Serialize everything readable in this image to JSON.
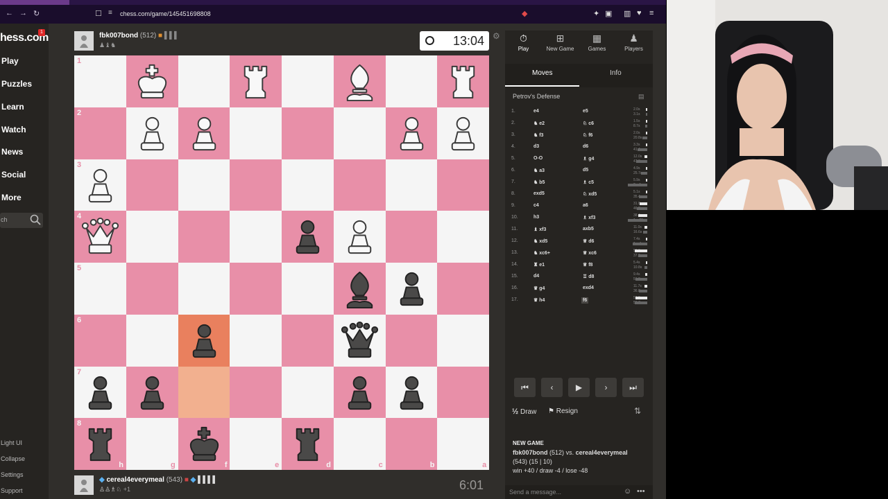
{
  "browser": {
    "url": "chess.com/game/145451698808"
  },
  "sidebar": {
    "logo": "hess.com",
    "badge": "1",
    "items": [
      "Play",
      "Puzzles",
      "Learn",
      "Watch",
      "News",
      "Social",
      "More"
    ],
    "search_placeholder": "ch",
    "footer": [
      "Light UI",
      "Collapse",
      "Settings",
      "Support"
    ]
  },
  "top_player": {
    "name": "fbk007bond",
    "rating": "(512)",
    "clock": "13:04"
  },
  "bottom_player": {
    "name": "cereal4everymeal",
    "rating": "(543)",
    "captured_extra": "+1",
    "clock": "6:01"
  },
  "board": {
    "ranks": [
      "1",
      "2",
      "3",
      "4",
      "5",
      "6",
      "7",
      "8"
    ],
    "files": [
      "h",
      "g",
      "f",
      "e",
      "d",
      "c",
      "b",
      "a"
    ]
  },
  "panel": {
    "tabs": [
      "Play",
      "New Game",
      "Games",
      "Players"
    ],
    "subtabs": [
      "Moves",
      "Info"
    ],
    "opening": "Petrov's Defense",
    "moves": [
      {
        "n": "1.",
        "w": "e4",
        "b": "e5",
        "tw": "2.0s",
        "tb": "3.1s"
      },
      {
        "n": "2.",
        "w": "e2",
        "b": "c6",
        "tw": "1.5s",
        "tb": "8.7s"
      },
      {
        "n": "3.",
        "w": "f3",
        "b": "f6",
        "tw": "2.0s",
        "tb": "20.8s"
      },
      {
        "n": "4.",
        "w": "d3",
        "b": "d6",
        "tw": "3.3s",
        "tb": "41.4s"
      },
      {
        "n": "5.",
        "w": "O-O",
        "b": "g4",
        "tw": "12.0s",
        "tb": "47.8s"
      },
      {
        "n": "6.",
        "w": "a3",
        "b": "d5",
        "tw": "4.9s",
        "tb": "25.7s"
      },
      {
        "n": "7.",
        "w": "b5",
        "b": "c5",
        "tw": "5.9s",
        "tb": "2m 1s"
      },
      {
        "n": "8.",
        "w": "exd5",
        "b": "xd5",
        "tw": "5.1s",
        "tb": "35.4s"
      },
      {
        "n": "9.",
        "w": "c4",
        "b": "a6",
        "tw": "31.8s",
        "tb": "46.2s"
      },
      {
        "n": "10.",
        "w": "h3",
        "b": "xf3",
        "tw": "38.4s",
        "tb": "1m 28s"
      },
      {
        "n": "11.",
        "w": "xf3",
        "b": "axb5",
        "tw": "11.0s",
        "tb": "16.6s"
      },
      {
        "n": "12.",
        "w": "xd5",
        "b": "d6",
        "tw": "7.4s",
        "tb": "1m 4s"
      },
      {
        "n": "13.",
        "w": "xc6+",
        "b": "xc6",
        "tw": "53.6s",
        "tb": "37.9s"
      },
      {
        "n": "14.",
        "w": "e1",
        "b": "f8",
        "tw": "5.4s",
        "tb": "10.8s"
      },
      {
        "n": "15.",
        "w": "d4",
        "b": "d8",
        "tw": "9.4s",
        "tb": "51.0s"
      },
      {
        "n": "16.",
        "w": "g4",
        "b": "exd4",
        "tw": "11.7s",
        "tb": "36.8s"
      },
      {
        "n": "17.",
        "w": "h4",
        "b": "f6",
        "tw": "50.0s",
        "tb": "53.7s"
      }
    ],
    "draw": "Draw",
    "draw_icon": "½",
    "resign": "Resign",
    "new_game_title": "NEW GAME",
    "ng_white": "fbk007bond",
    "ng_white_rating": "(512)",
    "ng_vs": "vs.",
    "ng_black": "cereal4everymeal",
    "ng_line2": "(543) (15 | 10)",
    "ng_line3": "win +40 / draw -4 / lose -48",
    "message_placeholder": "Send a message..."
  },
  "colors": {
    "light_square": "#f5f5f5",
    "dark_square": "#e88fa8",
    "highlight": "#e9805e",
    "bg": "#302e2b"
  }
}
